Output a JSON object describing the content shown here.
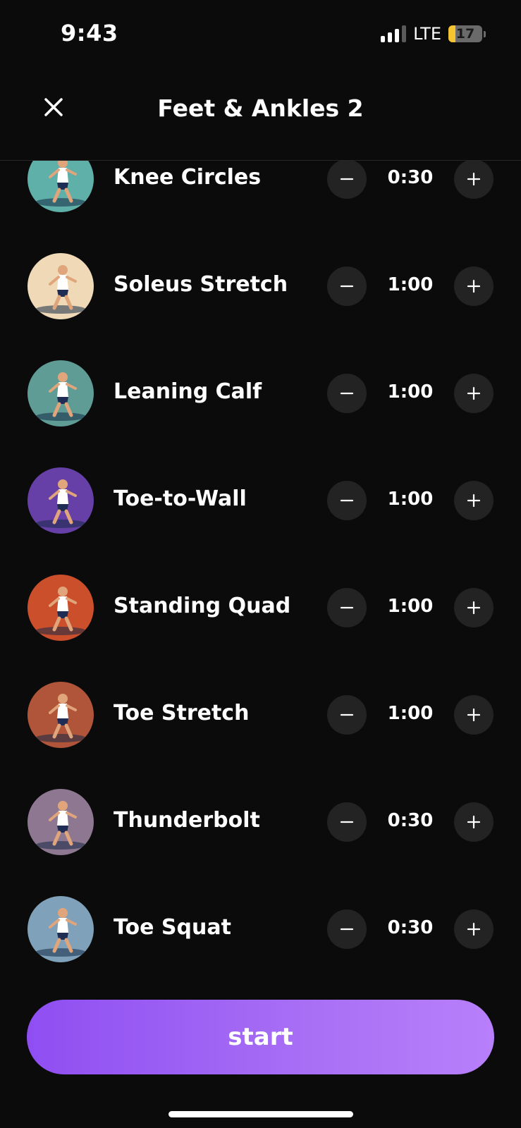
{
  "status_bar": {
    "time": "9:43",
    "network": "LTE",
    "battery": "17"
  },
  "header": {
    "title": "Feet & Ankles 2",
    "close_icon": "close-icon"
  },
  "exercises": [
    {
      "name": "Knee Circles",
      "duration": "0:30",
      "color": "#5fb0a8"
    },
    {
      "name": "Soleus Stretch",
      "duration": "1:00",
      "color": "#efd9b6"
    },
    {
      "name": "Leaning Calf",
      "duration": "1:00",
      "color": "#5e9c95"
    },
    {
      "name": "Toe-to-Wall",
      "duration": "1:00",
      "color": "#6640a7"
    },
    {
      "name": "Standing Quad",
      "duration": "1:00",
      "color": "#cc4f2c"
    },
    {
      "name": "Toe Stretch",
      "duration": "1:00",
      "color": "#b0553a"
    },
    {
      "name": "Thunderbolt",
      "duration": "0:30",
      "color": "#8e7790"
    },
    {
      "name": "Toe Squat",
      "duration": "0:30",
      "color": "#7fa2ba"
    }
  ],
  "start_button": {
    "label": "start"
  },
  "colors": {
    "accent": "#9b5cf6",
    "background": "#0b0b0b",
    "stepper": "#232323"
  }
}
